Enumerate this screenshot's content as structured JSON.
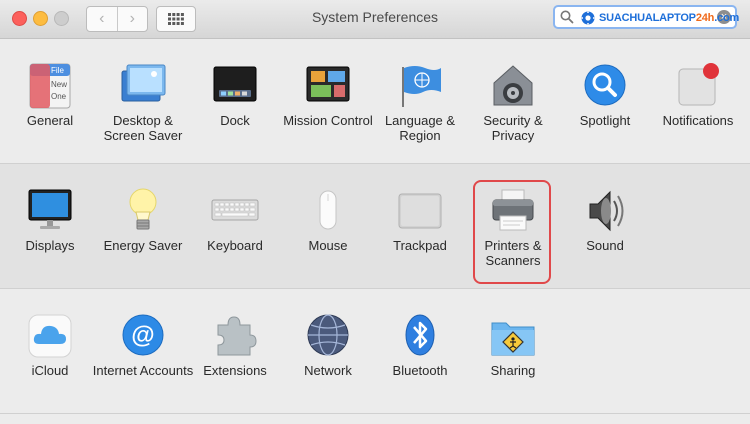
{
  "window": {
    "title": "System Preferences",
    "nav_back": "‹",
    "nav_forward": "›",
    "search_clear": "×"
  },
  "watermark": {
    "brand_part1": "SUACHUALAPTOP",
    "brand_part2": "24h",
    "brand_part3": ".com"
  },
  "sections": {
    "personal": [
      {
        "label": "General",
        "icon": "general-icon"
      },
      {
        "label": "Desktop & Screen Saver",
        "icon": "desktop-screensaver-icon"
      },
      {
        "label": "Dock",
        "icon": "dock-icon"
      },
      {
        "label": "Mission Control",
        "icon": "mission-control-icon"
      },
      {
        "label": "Language & Region",
        "icon": "language-region-icon"
      },
      {
        "label": "Security & Privacy",
        "icon": "security-privacy-icon"
      },
      {
        "label": "Spotlight",
        "icon": "spotlight-icon"
      },
      {
        "label": "Notifications",
        "icon": "notifications-icon"
      }
    ],
    "hardware": [
      {
        "label": "Displays",
        "icon": "displays-icon"
      },
      {
        "label": "Energy Saver",
        "icon": "energy-saver-icon"
      },
      {
        "label": "Keyboard",
        "icon": "keyboard-icon"
      },
      {
        "label": "Mouse",
        "icon": "mouse-icon"
      },
      {
        "label": "Trackpad",
        "icon": "trackpad-icon"
      },
      {
        "label": "Printers & Scanners",
        "icon": "printers-scanners-icon"
      },
      {
        "label": "Sound",
        "icon": "sound-icon"
      }
    ],
    "internet": [
      {
        "label": "iCloud",
        "icon": "icloud-icon"
      },
      {
        "label": "Internet Accounts",
        "icon": "internet-accounts-icon"
      },
      {
        "label": "Extensions",
        "icon": "extensions-icon"
      },
      {
        "label": "Network",
        "icon": "network-icon"
      },
      {
        "label": "Bluetooth",
        "icon": "bluetooth-icon"
      },
      {
        "label": "Sharing",
        "icon": "sharing-icon"
      }
    ]
  },
  "general_icon_text": {
    "line1": "File",
    "line2": "New",
    "line3": "One"
  },
  "colors": {
    "highlight": "#e0484a",
    "close": "#fc605c",
    "minimize": "#fdbc40",
    "search_focus": "#8ab5f0"
  }
}
